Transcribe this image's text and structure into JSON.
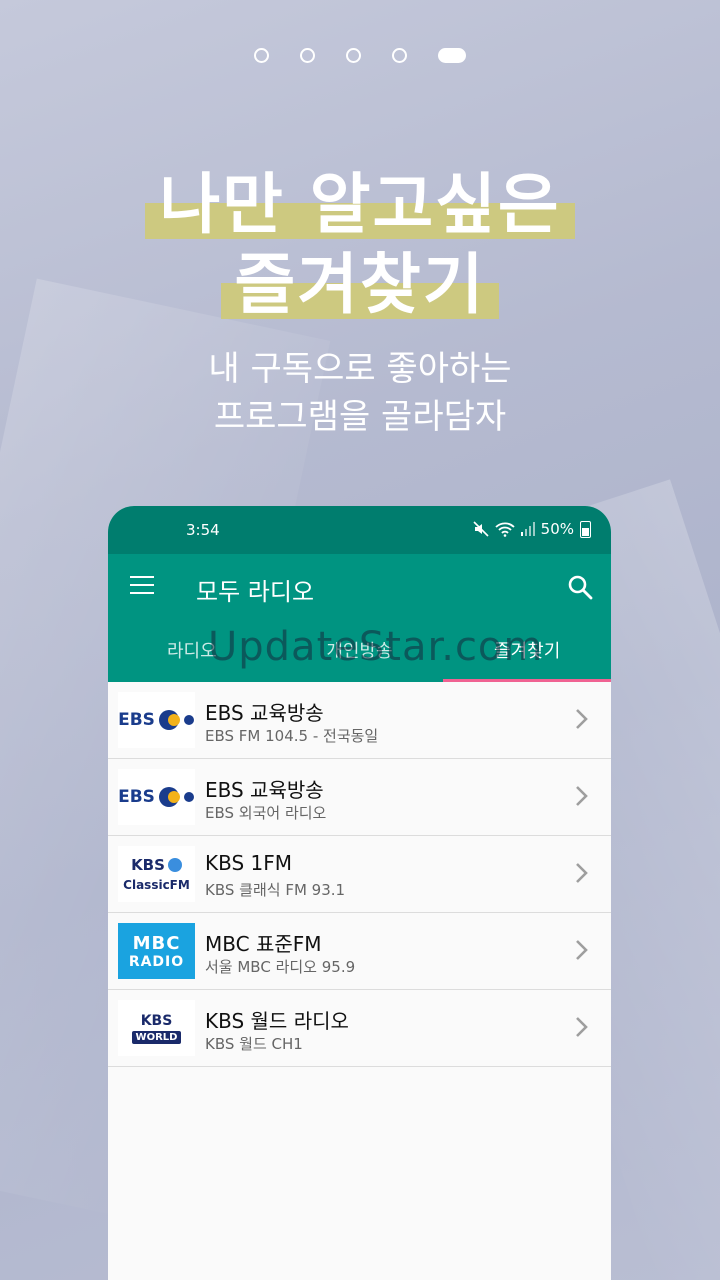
{
  "onboarding": {
    "page_count": 5,
    "active_page": 5,
    "headline": [
      "나만 알고싶은",
      "즐겨찾기"
    ],
    "subtitle": [
      "내 구독으로 좋아하는",
      "프로그램을 골라담자"
    ]
  },
  "status_bar": {
    "time": "3:54",
    "battery": "50%",
    "icons": [
      "mute-icon",
      "wifi-icon",
      "signal-icon",
      "battery-icon"
    ]
  },
  "app_bar": {
    "title": "모두 라디오",
    "menu_icon": "hamburger-icon",
    "search_icon": "search-icon"
  },
  "tabs": [
    {
      "label": "라디오",
      "active": false
    },
    {
      "label": "개인방송",
      "active": false
    },
    {
      "label": "즐겨찾기",
      "active": true
    }
  ],
  "watermark": "UpdateStar.com",
  "favorites": [
    {
      "title": "EBS 교육방송",
      "subtitle": "EBS FM 104.5 - 전국동일",
      "logo": "ebs"
    },
    {
      "title": "EBS 교육방송",
      "subtitle": "EBS 외국어 라디오",
      "logo": "ebs"
    },
    {
      "title": "KBS 1FM",
      "subtitle": "KBS 클래식 FM 93.1",
      "logo": "kbs-classic"
    },
    {
      "title": "MBC 표준FM",
      "subtitle": "서울 MBC 라디오 95.9",
      "logo": "mbc"
    },
    {
      "title": "KBS 월드 라디오",
      "subtitle": "KBS 월드 CH1",
      "logo": "kbs-world"
    }
  ],
  "logos": {
    "ebs": "EBS",
    "kbs": "KBS",
    "classic_fm": "ClassicFM",
    "mbc_top": "MBC",
    "mbc_bottom": "RADIO",
    "world": "WORLD"
  },
  "colors": {
    "status_bar": "#007d6e",
    "app_bar": "#009481",
    "tab_indicator": "#f06292",
    "highlight": "#cdc980"
  }
}
